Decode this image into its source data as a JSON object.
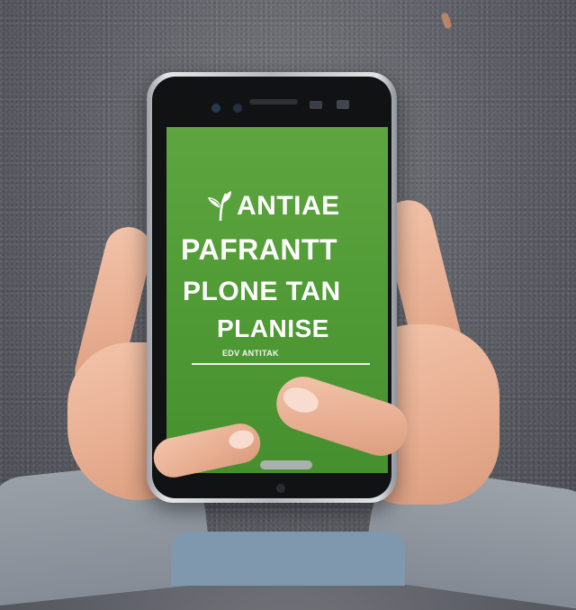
{
  "screen": {
    "title_lines": [
      "ANTIAE",
      "PAFRANTT",
      "PLONE TAN",
      "PLANISE"
    ],
    "subtitle": "EDV ANTITAK",
    "leaf_icon": "leaf-icon"
  },
  "colors": {
    "screen_green": "#5ea53f",
    "text": "#ffffff",
    "background": "#5d5f66"
  }
}
